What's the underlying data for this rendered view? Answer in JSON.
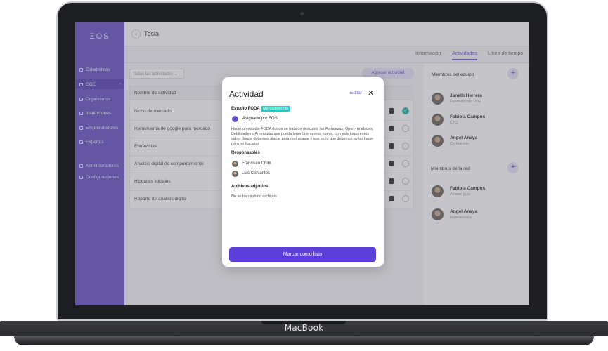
{
  "device": {
    "brand": "MacBook"
  },
  "app": {
    "logo": "ΞOS",
    "sidebar": {
      "items": [
        {
          "label": "Estadísticas"
        },
        {
          "label": "ODE",
          "active": true
        },
        {
          "label": "Organismos"
        },
        {
          "label": "Instituciones"
        },
        {
          "label": "Emprendedores"
        },
        {
          "label": "Expertos"
        },
        {
          "label": "Administradores"
        },
        {
          "label": "Configuraciones"
        }
      ]
    },
    "header": {
      "back_icon": "‹",
      "title": "Tesla"
    },
    "tabs": [
      {
        "label": "Información"
      },
      {
        "label": "Actividades",
        "active": true
      },
      {
        "label": "Línea de tiempo"
      }
    ],
    "toolbar": {
      "filter_value": "Todas las actividades",
      "add_label": "Agregar actividad"
    },
    "table": {
      "header": "Nombre de actividad",
      "rows": [
        {
          "name": "Nicho de mercado",
          "done": true
        },
        {
          "name": "Herramienta de google para mercado",
          "done": false
        },
        {
          "name": "Entrevistas",
          "done": false
        },
        {
          "name": "Analisis digital de comportamiento",
          "done": false
        },
        {
          "name": "Hipotesis iniciales",
          "done": false
        },
        {
          "name": "Reporte de analisis digital",
          "done": false
        }
      ]
    },
    "team": {
      "title": "Miembros del equipo",
      "members": [
        {
          "name": "Janeth Herrera",
          "role": "Fundador de ODE"
        },
        {
          "name": "Fabiola Campos",
          "role": "CTO"
        },
        {
          "name": "Angel Anaya",
          "role": "Co founder"
        }
      ]
    },
    "network": {
      "title": "Miembros de la red",
      "members": [
        {
          "name": "Fabiola Campos",
          "role": "Asesor guia"
        },
        {
          "name": "Angel Anaya",
          "role": "Inversionista"
        }
      ]
    },
    "modal": {
      "title": "Actividad",
      "edit_label": "Editar",
      "close_label": "✕",
      "subtitle": "Estudio FODA",
      "tag": "Mercadotécnia",
      "assigned": "Asignado por EOS",
      "description": "Hacer un estudio FODA donde se trata de descubrir las Fortalezas, Oport- unidades, Debilidades y Amenazas que pueda tener la empresa nueva, con esto lograremos saber donde debemos atacar para no fracasar y que es lo que debemos evitar hacer para no fracasar",
      "responsables_title": "Responsables",
      "responsables": [
        {
          "name": "Francisco Chim"
        },
        {
          "name": "Luis Cervantes"
        }
      ],
      "files_title": "Archivos adjuntos",
      "files_empty": "No se han subido archivos",
      "primary_button": "Marcar como listo"
    }
  }
}
